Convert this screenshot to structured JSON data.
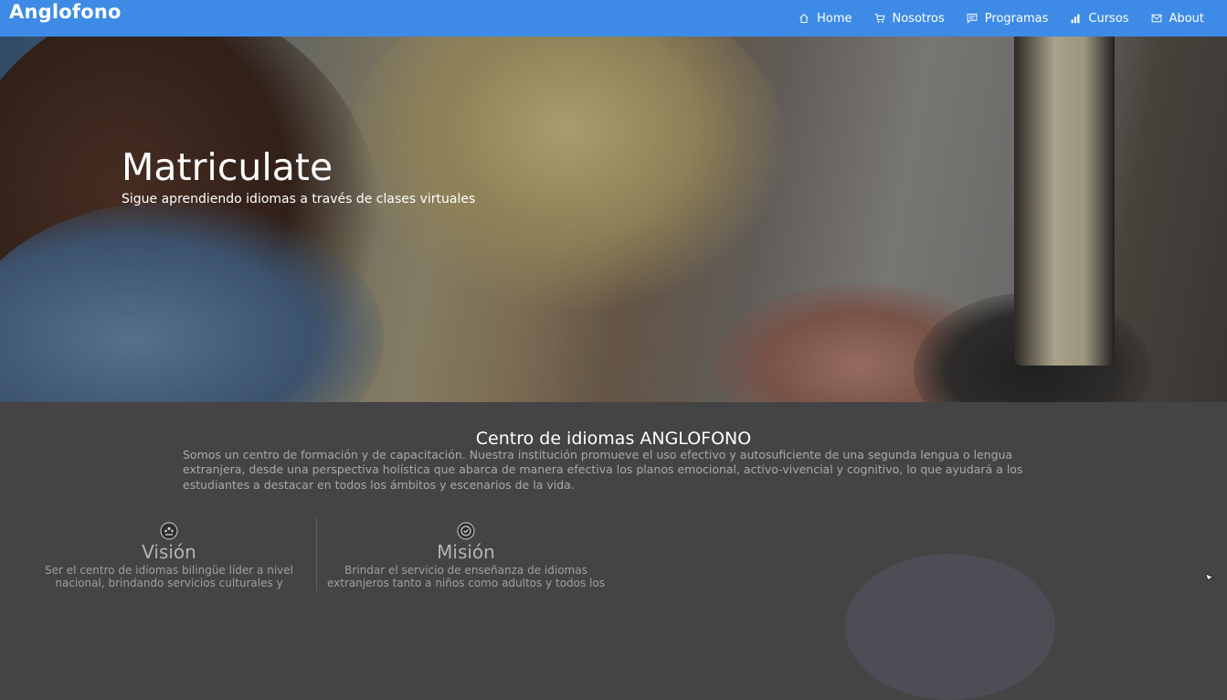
{
  "navbar": {
    "brand": "Anglofono",
    "items": [
      {
        "label": "Home",
        "icon": "home-icon"
      },
      {
        "label": "Nosotros",
        "icon": "cart-icon"
      },
      {
        "label": "Programas",
        "icon": "chat-icon"
      },
      {
        "label": "Cursos",
        "icon": "bar-chart-icon"
      },
      {
        "label": "About",
        "icon": "envelope-icon"
      }
    ],
    "color": "#3d8be6"
  },
  "hero": {
    "title": "Matriculate",
    "subtitle": "Sigue aprendiendo idiomas a través de clases virtuales"
  },
  "about": {
    "title": "Centro de idiomas ANGLOFONO",
    "text": "Somos un centro de formación y de capacitación. Nuestra institución promueve el uso efectivo y autosuficiente de una segunda lengua o lengua extranjera, desde una perspectiva holística que abarca de manera efectiva los planos emocional, activo-vivencial y cognitivo, lo que ayudará a los estudiantes a destacar en todos los ámbitos y escenarios de la vida."
  },
  "columns": [
    {
      "title": "Visión",
      "icon": "people-icon",
      "text": "Ser el centro de idiomas bilingüe líder a nivel nacional, brindando servicios culturales y"
    },
    {
      "title": "Misión",
      "icon": "check-circle-icon",
      "text": "Brindar el servicio de enseñanza de idiomas extranjeros tanto a niños como adultos y todos los"
    }
  ]
}
